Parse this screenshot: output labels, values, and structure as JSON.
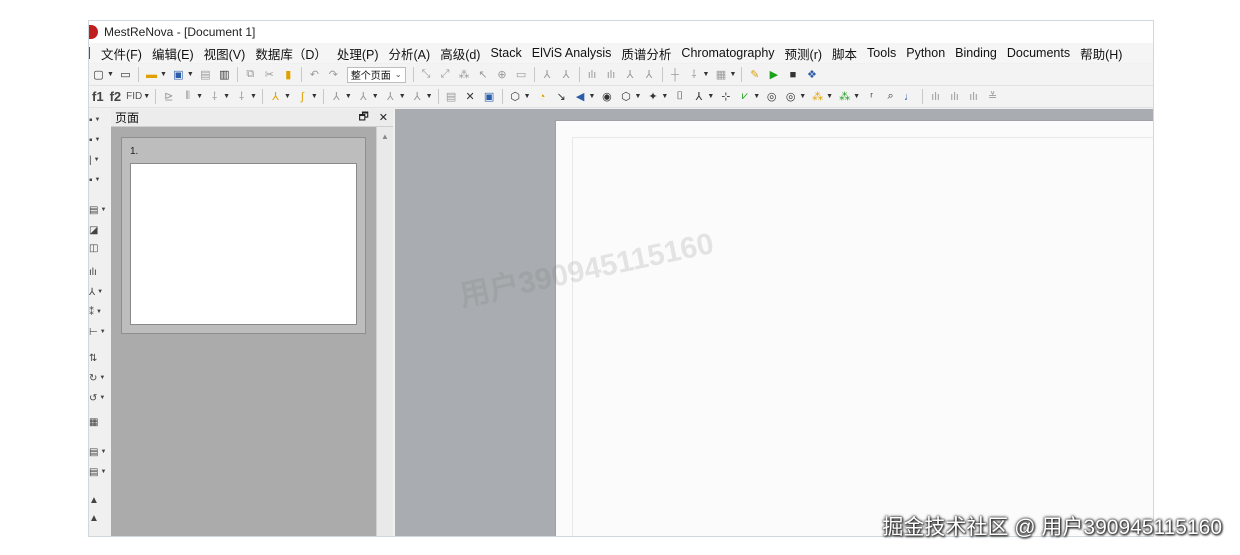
{
  "window": {
    "title": "MestReNova - [Document 1]"
  },
  "menu": [
    "文件(F)",
    "编辑(E)",
    "视图(V)",
    "数据库（D）",
    "处理(P)",
    "分析(A)",
    "高级(d)",
    "Stack",
    "ElViS Analysis",
    "质谱分析",
    "Chromatography",
    "预测(r)",
    "脚本",
    "Tools",
    "Python",
    "Binding",
    "Documents",
    "帮助(H)"
  ],
  "toolbar": {
    "zoom_select": "整个页面",
    "f1_label": "f1",
    "f2_label": "f2",
    "fid_label": "FID"
  },
  "icons": {
    "run": "play-icon",
    "stop": "stop-icon",
    "python": "python-icon",
    "new": "new-document-icon",
    "open": "open-folder-icon",
    "save": "save-icon"
  },
  "colors": {
    "run": "#1aa31a",
    "stop": "#555555",
    "folder": "#e0a000",
    "workspace": "#a9acb0",
    "pane_body": "#ababab"
  },
  "pages_pane": {
    "title": "页面",
    "restore_icon": "🗗",
    "close_icon": "✕",
    "thumbnails": [
      {
        "number": "1."
      }
    ]
  },
  "watermark": "用户390945115160",
  "footer": "掘金技术社区 @ 用户390945115160"
}
